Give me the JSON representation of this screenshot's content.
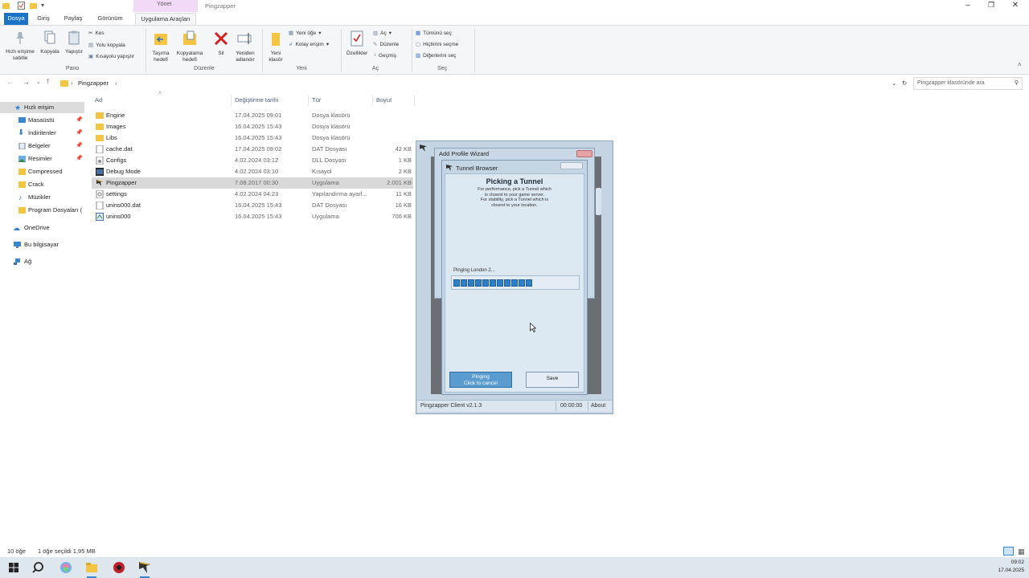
{
  "window": {
    "ribbon_context_label": "Yönet",
    "app_title": "Pingzapper"
  },
  "ribbon_tabs": [
    "Dosya",
    "Giriş",
    "Paylaş",
    "Görünüm",
    "Uygulama Araçları"
  ],
  "ribbon": {
    "pano": {
      "label": "Pano",
      "pin": "Hızlı erişime sabitle",
      "copy": "Kopyala",
      "paste": "Yapıştır",
      "cut": "Kes",
      "copy_path": "Yolu kopyala",
      "paste_shortcut": "Kısayolu yapıştır"
    },
    "duzenle": {
      "label": "Düzenle",
      "move_to": "Taşıma hedefi",
      "copy_to": "Kopyalama hedefi",
      "delete": "Sil",
      "rename": "Yeniden adlandır"
    },
    "yeni": {
      "label": "Yeni",
      "new_folder": "Yeni klasör",
      "new_item": "Yeni öğe",
      "easy_access": "Kolay erişim"
    },
    "ac": {
      "label": "Aç",
      "properties": "Özellikler",
      "open": "Aç",
      "edit": "Düzenle",
      "history": "Geçmiş"
    },
    "sec": {
      "label": "Seç",
      "select_all": "Tümünü seç",
      "select_none": "Hiçbirini seçme",
      "invert": "Diğerlerini seç"
    }
  },
  "address": {
    "path": "Pingzapper",
    "search_placeholder": "Pingzapper klasöründe ara"
  },
  "nav": [
    {
      "label": "Hızlı erişim",
      "icon": "star-icon",
      "selected": true
    },
    {
      "label": "Masaüstü",
      "icon": "desktop-icon",
      "pinned": true
    },
    {
      "label": "İndirilenler",
      "icon": "download-icon",
      "pinned": true
    },
    {
      "label": "Belgeler",
      "icon": "documents-icon",
      "pinned": true
    },
    {
      "label": "Resimler",
      "icon": "pictures-icon",
      "pinned": true
    },
    {
      "label": "Compressed",
      "icon": "folder-icon"
    },
    {
      "label": "Crack",
      "icon": "folder-icon"
    },
    {
      "label": "Müzikler",
      "icon": "music-icon"
    },
    {
      "label": "Program Dosyaları (",
      "icon": "folder-icon"
    },
    {
      "label": "OneDrive",
      "icon": "cloud-icon"
    },
    {
      "label": "Bu bilgisayar",
      "icon": "computer-icon"
    },
    {
      "label": "Ağ",
      "icon": "network-icon"
    }
  ],
  "columns": [
    "Ad",
    "Değiştirme tarihi",
    "Tür",
    "Boyut"
  ],
  "files": [
    {
      "name": "Engine",
      "date": "17.04.2025 09:01",
      "type": "Dosya klasörü",
      "size": "",
      "icon": "folder-icon"
    },
    {
      "name": "Images",
      "date": "16.04.2025 15:43",
      "type": "Dosya klasörü",
      "size": "",
      "icon": "folder-icon"
    },
    {
      "name": "Libs",
      "date": "16.04.2025 15:43",
      "type": "Dosya klasörü",
      "size": "",
      "icon": "folder-icon"
    },
    {
      "name": "cache.dat",
      "date": "17.04.2025 09:02",
      "type": "DAT Dosyası",
      "size": "42 KB",
      "icon": "file-icon"
    },
    {
      "name": "Configs",
      "date": "4.02.2024 03:12",
      "type": "DLL Dosyası",
      "size": "1 KB",
      "icon": "dll-icon"
    },
    {
      "name": "Debug Mode",
      "date": "4.02.2024 03:10",
      "type": "Kısayol",
      "size": "2 KB",
      "icon": "shortcut-icon"
    },
    {
      "name": "Pingzapper",
      "date": "7.08.2017 00:30",
      "type": "Uygulama",
      "size": "2.001 KB",
      "icon": "pingzapper-icon",
      "selected": true
    },
    {
      "name": "settings",
      "date": "4.02.2024 04:23",
      "type": "Yapılandırma ayarl...",
      "size": "11 KB",
      "icon": "settings-file-icon"
    },
    {
      "name": "unins000.dat",
      "date": "16.04.2025 15:43",
      "type": "DAT Dosyası",
      "size": "16 KB",
      "icon": "file-icon"
    },
    {
      "name": "unins000",
      "date": "16.04.2025 15:43",
      "type": "Uygulama",
      "size": "706 KB",
      "icon": "uninstaller-icon"
    }
  ],
  "status": {
    "count": "10 öğe",
    "selection": "1 öğe seçildi  1,95 MB"
  },
  "pingzapper": {
    "wizard_title": "Add Profile Wizard",
    "browser_title": "Tunnel Browser",
    "heading": "Picking a Tunnel",
    "desc_1": "For performance, pick a Tunnel which",
    "desc_2": "is closest to your game server.",
    "desc_3": "For stability, pick a Tunnel which is",
    "desc_4": "closest to your location.",
    "ping_label": "Pinging London 2...",
    "progress_segments": 11,
    "btn_pinging": "Pinging",
    "btn_cancel": "Click to cancel",
    "btn_save": "Save",
    "client_version": "Pingzapper Client v2.1.3",
    "timer": "00:00:00",
    "about": "About"
  },
  "tray": {
    "time": "09:02",
    "date": "17.04.2025"
  }
}
